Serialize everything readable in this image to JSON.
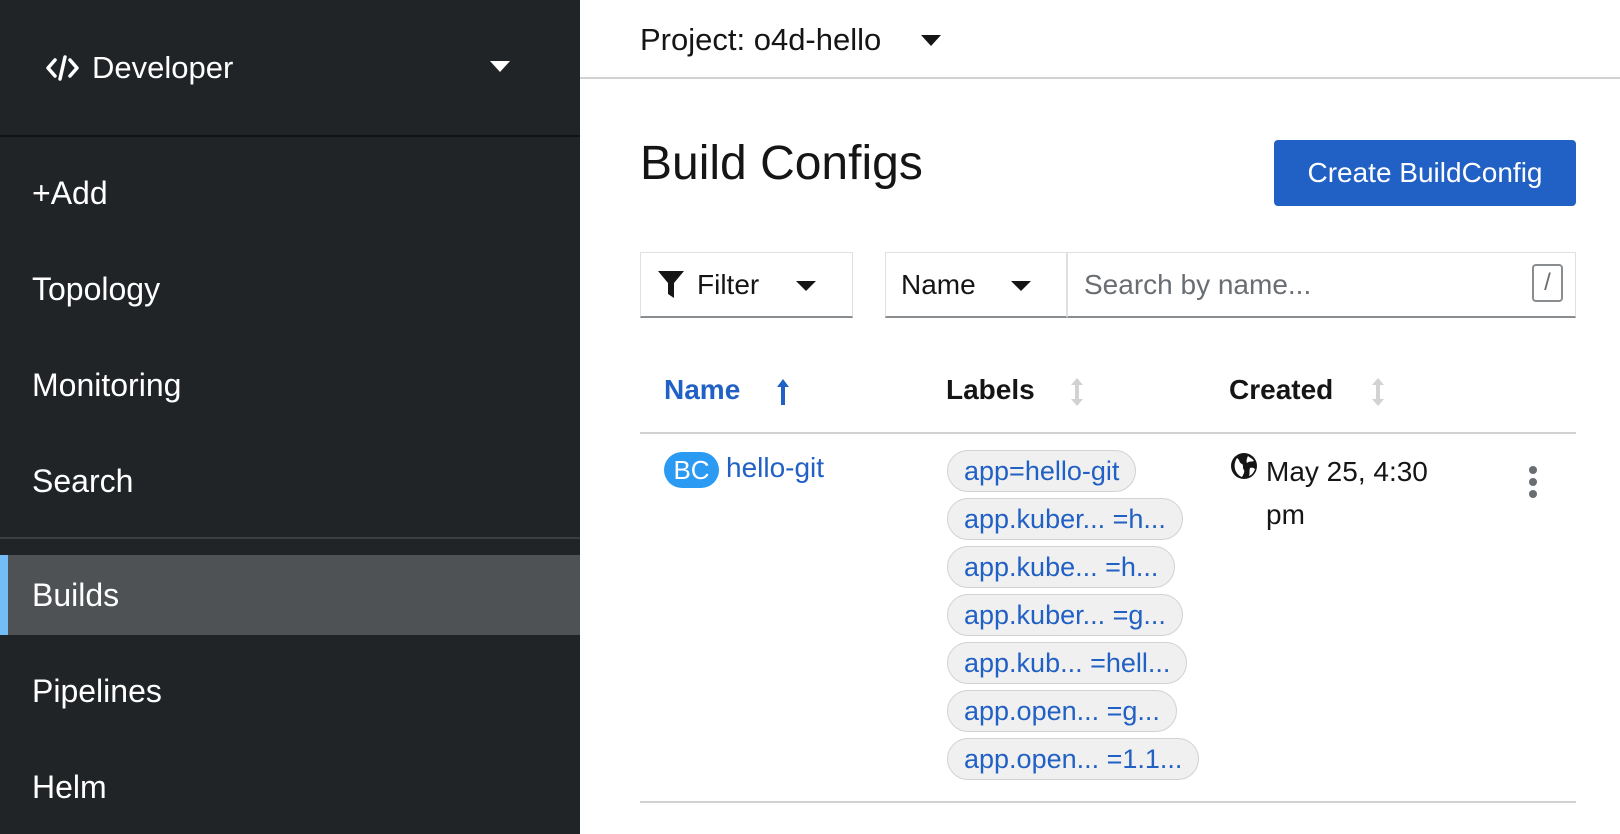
{
  "perspective": {
    "label": "Developer",
    "icon": "code-icon"
  },
  "sidebar": {
    "items": [
      {
        "label": "+Add"
      },
      {
        "label": "Topology"
      },
      {
        "label": "Monitoring"
      },
      {
        "label": "Search"
      },
      {
        "label": "Builds",
        "active": true
      },
      {
        "label": "Pipelines"
      },
      {
        "label": "Helm"
      }
    ]
  },
  "project": {
    "label": "Project: o4d-hello"
  },
  "page": {
    "title": "Build Configs",
    "create_label": "Create BuildConfig"
  },
  "toolbar": {
    "filter_label": "Filter",
    "filter_by": "Name",
    "search_placeholder": "Search by name...",
    "shortcut_key": "/"
  },
  "table": {
    "columns": [
      {
        "label": "Name",
        "sort": "ascending"
      },
      {
        "label": "Labels",
        "sort": "none"
      },
      {
        "label": "Created",
        "sort": "none"
      }
    ],
    "rows": [
      {
        "badge": "BC",
        "name": "hello-git",
        "labels": [
          "app=hello-git",
          "app.kuber... =h...",
          "app.kube... =h...",
          "app.kuber... =g...",
          "app.kub... =hell...",
          "app.open... =g...",
          "app.open... =1.1..."
        ],
        "created": "May 25, 4:30 pm"
      }
    ]
  },
  "colors": {
    "accent": "#2160c4",
    "sidebar_bg": "#212427",
    "active_indicator": "#73bcf7",
    "badge": "#2b9af3"
  }
}
